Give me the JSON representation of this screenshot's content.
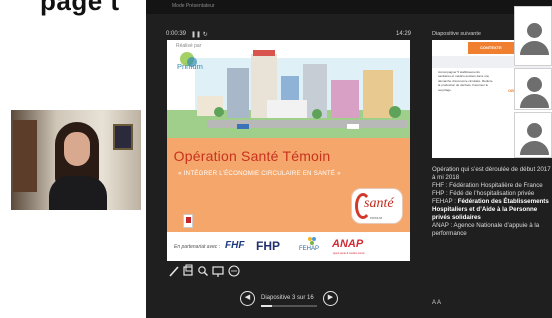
{
  "top_heading": "page t",
  "window": {
    "title": "Mode Présentateur",
    "timer": "0:00:39",
    "timer_controls": "❚❚  ↻",
    "clock": "14:29"
  },
  "slide": {
    "realise_par": "Réalisé par",
    "primum_label": "Primum",
    "title": "Opération Santé Témoin",
    "subtitle": "« INTÉGRER L’ÉCONOMIE CIRCULAIRE EN SANTÉ »",
    "sante_logo": "santé",
    "sante_small": "PRIMUM",
    "partner_label": "En partenariat avec :",
    "partners": {
      "fhf": "FHF",
      "fhp": "FHP",
      "fehap": "FEHAP",
      "anap": "ANAP",
      "anap_small": "appui santé & médico-social"
    }
  },
  "tools": [
    "pen-icon",
    "laser-slides-icon",
    "zoom-icon",
    "screen-icon",
    "more-icon"
  ],
  "navigation": {
    "prev": "◀",
    "next": "▶",
    "label": "Diapositive 3 sur 16",
    "progress": 0.1875
  },
  "next_slide": {
    "label": "Diapositive suivante",
    "header": "CONTEXTE",
    "body": "Accompagner 5 établissements sanitaires et médico-sociaux dans une démarche d’économie circulaire. Réduire la production de déchets. Favoriser le recyclage.",
    "right_label": "OBJECTIFS"
  },
  "notes": {
    "line1": "Opération qui s’est déroulée de début 2017 à mi 2018",
    "line2": "FHF : Fédération Hospitalière de France",
    "line3": "FHP : Fédé de l’hospitalisation privée",
    "line4_prefix": "FEHAP : ",
    "line4_bold": "Fédération des Établissements Hospitaliers et d’Aide à la Personne privés solidaires",
    "line5": "ANAP : Agence Nationale d’appuie à la performance"
  },
  "font_controls": "A  A"
}
